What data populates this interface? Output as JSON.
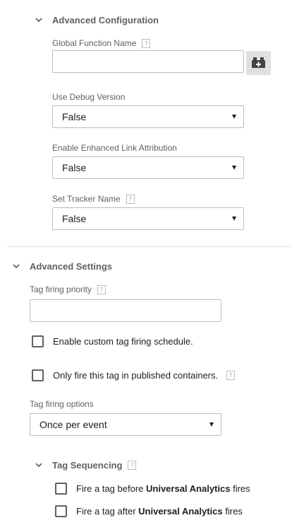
{
  "advanced_configuration": {
    "title": "Advanced Configuration",
    "global_function_name": {
      "label": "Global Function Name",
      "value": "",
      "variable_button_icon": "variable-brick-plus-icon"
    },
    "use_debug_version": {
      "label": "Use Debug Version",
      "selected": "False"
    },
    "enhanced_link_attribution": {
      "label": "Enable Enhanced Link Attribution",
      "selected": "False"
    },
    "set_tracker_name": {
      "label": "Set Tracker Name",
      "selected": "False"
    }
  },
  "advanced_settings": {
    "title": "Advanced Settings",
    "tag_firing_priority": {
      "label": "Tag firing priority",
      "value": ""
    },
    "custom_schedule": {
      "label": "Enable custom tag firing schedule.",
      "checked": false
    },
    "published_only": {
      "label": "Only fire this tag in published containers.",
      "checked": false
    },
    "tag_firing_options": {
      "label": "Tag firing options",
      "selected": "Once per event"
    },
    "tag_sequencing": {
      "title": "Tag Sequencing",
      "before": {
        "prefix": "Fire a tag before ",
        "tag_name": "Universal Analytics",
        "suffix": " fires",
        "checked": false
      },
      "after": {
        "prefix": "Fire a tag after ",
        "tag_name": "Universal Analytics",
        "suffix": " fires",
        "checked": false
      }
    }
  },
  "icons": {
    "help": "?",
    "collapse": "chevron-down-icon"
  },
  "colors": {
    "label": "#616161",
    "border": "#bdbdbd",
    "text": "#212121",
    "button_bg": "#e0e0e0"
  }
}
